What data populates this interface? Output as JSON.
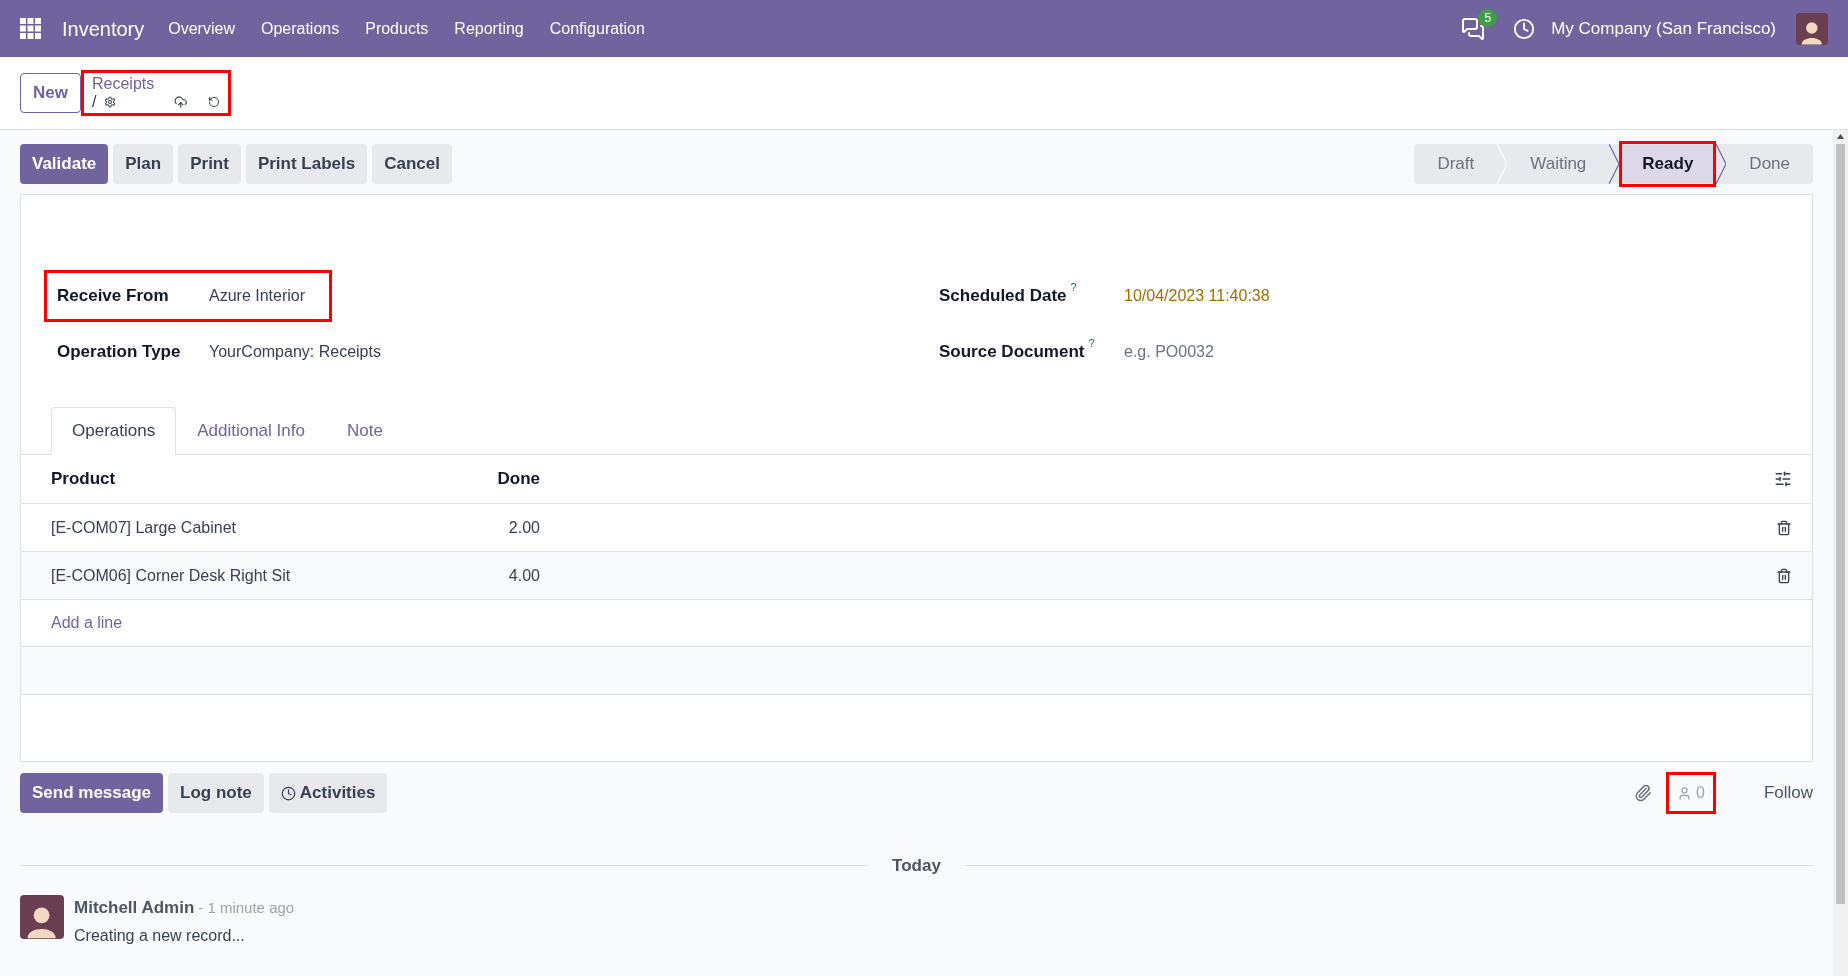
{
  "navbar": {
    "app": "Inventory",
    "menu": [
      "Overview",
      "Operations",
      "Products",
      "Reporting",
      "Configuration"
    ],
    "chat_badge": "5",
    "company": "My Company (San Francisco)"
  },
  "control_panel": {
    "new_button": "New",
    "breadcrumb": {
      "title": "Receipts",
      "separator": "/",
      "highlighted": true
    }
  },
  "actions": [
    {
      "label": "Validate",
      "primary": true
    },
    {
      "label": "Plan",
      "primary": false
    },
    {
      "label": "Print",
      "primary": false
    },
    {
      "label": "Print Labels",
      "primary": false
    },
    {
      "label": "Cancel",
      "primary": false
    }
  ],
  "stages": [
    {
      "label": "Draft",
      "selected": false,
      "highlighted": false
    },
    {
      "label": "Waiting",
      "selected": false,
      "highlighted": false
    },
    {
      "label": "Ready",
      "selected": true,
      "highlighted": true
    },
    {
      "label": "Done",
      "selected": false,
      "highlighted": false
    }
  ],
  "fields_left": [
    {
      "label": "Receive From",
      "value": "Azure Interior",
      "highlighted": true
    },
    {
      "label": "Operation Type",
      "value": "YourCompany: Receipts",
      "highlighted": false
    }
  ],
  "fields_right": [
    {
      "label": "Scheduled Date",
      "help": "?",
      "value": "10/04/2023 11:40:38",
      "kind": "date"
    },
    {
      "label": "Source Document",
      "help": "?",
      "placeholder": "e.g. PO0032",
      "kind": "input"
    }
  ],
  "tabs": [
    {
      "label": "Operations",
      "selected": true
    },
    {
      "label": "Additional Info",
      "selected": false
    },
    {
      "label": "Note",
      "selected": false
    }
  ],
  "table": {
    "columns": [
      "Product",
      "Done"
    ],
    "rows": [
      {
        "product": "[E-COM07] Large Cabinet",
        "done": "2.00"
      },
      {
        "product": "[E-COM06] Corner Desk Right Sit",
        "done": "4.00"
      }
    ],
    "add_line": "Add a line"
  },
  "chatter": {
    "buttons": [
      {
        "label": "Send message",
        "kind": "primary"
      },
      {
        "label": "Log note",
        "kind": "plain"
      },
      {
        "label": "Activities",
        "kind": "activities"
      }
    ],
    "followers": {
      "count": "0",
      "highlighted": true
    },
    "follow": "Follow",
    "date_separator": "Today",
    "messages": [
      {
        "author": "Mitchell Admin",
        "time": "- 1 minute ago",
        "body": "Creating a new record..."
      }
    ]
  }
}
